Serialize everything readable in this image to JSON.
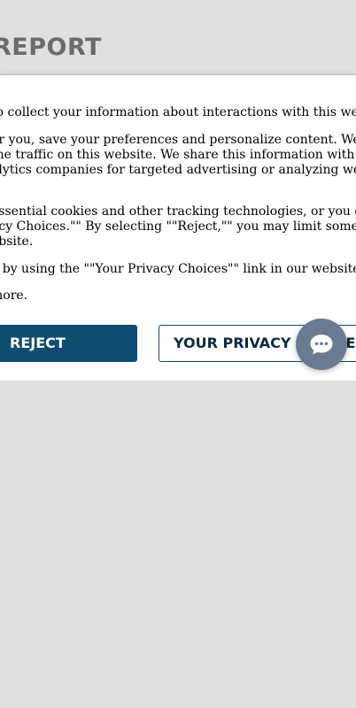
{
  "page": {
    "title": "REPORT"
  },
  "cookie_banner": {
    "lines": [
      "to collect your information about interactions with this website.",
      "or you, save your preferences and personalize content. We also use",
      "the traffic on this website. We share this information with social",
      "alytics companies for targeted advertising or analyzing website",
      "essential cookies and other tracking technologies, or you can",
      "acy Choices.\"\" By selecting \"\"Reject,\"\" you may limit some website",
      "ebsite.",
      "e by using the \"\"Your Privacy Choices\"\" link in our website footer.",
      "more."
    ],
    "reject_label": "REJECT",
    "privacy_choices_label": "YOUR PRIVACY CHOICES"
  },
  "chat": {
    "icon": "chat-bubble-icon"
  },
  "colors": {
    "background": "#e0e0e0",
    "primary": "#0e4d6e",
    "chat_button": "#6a7a91",
    "title": "#6b6b6b"
  }
}
